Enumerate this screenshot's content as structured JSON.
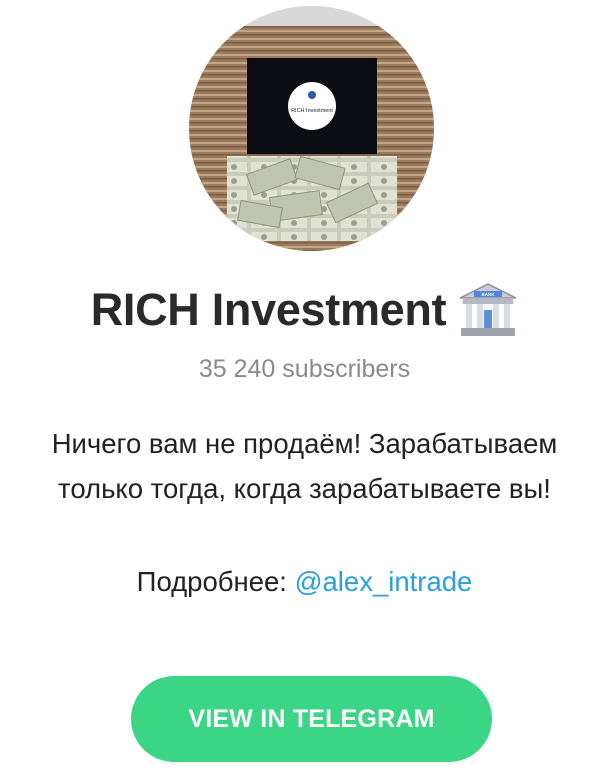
{
  "channel": {
    "name": "RICH Investment",
    "name_icon": "bank-building-icon",
    "subscribers": "35 240 subscribers",
    "avatar_logo_text": "RICH Investment"
  },
  "description": {
    "line1": "Ничего вам не продаём! Зарабатываем",
    "line2": "только тогда, когда зарабатываете вы!"
  },
  "more": {
    "prefix": "Подробнее: ",
    "link": "@alex_intrade"
  },
  "button": {
    "label": "VIEW IN TELEGRAM"
  },
  "colors": {
    "button_bg": "#3ad585",
    "link": "#2a9fd8",
    "subscribers": "#8a8a8a"
  }
}
